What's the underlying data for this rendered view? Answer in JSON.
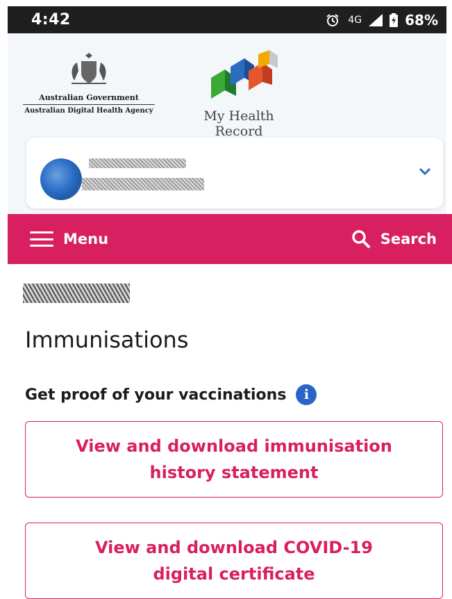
{
  "status_bar": {
    "time": "4:42",
    "alarm_icon": "alarm-icon",
    "network": "4G",
    "signal_icon": "signal-icon",
    "battery_icon": "battery-charging-icon",
    "battery": "68%"
  },
  "header": {
    "gov_line1": "Australian Government",
    "gov_line2": "Australian Digital Health Agency",
    "mhr_name": "My Health Record",
    "profile_chevron_icon": "chevron-down-icon"
  },
  "nav": {
    "menu_label": "Menu",
    "search_label": "Search",
    "brand_color": "#d81f5f"
  },
  "content": {
    "title": "Immunisations",
    "proof_heading": "Get proof of your vaccinations",
    "buttons": {
      "history": "View and download immunisation history statement",
      "covid": "View and download COVID-19 digital certificate"
    }
  }
}
